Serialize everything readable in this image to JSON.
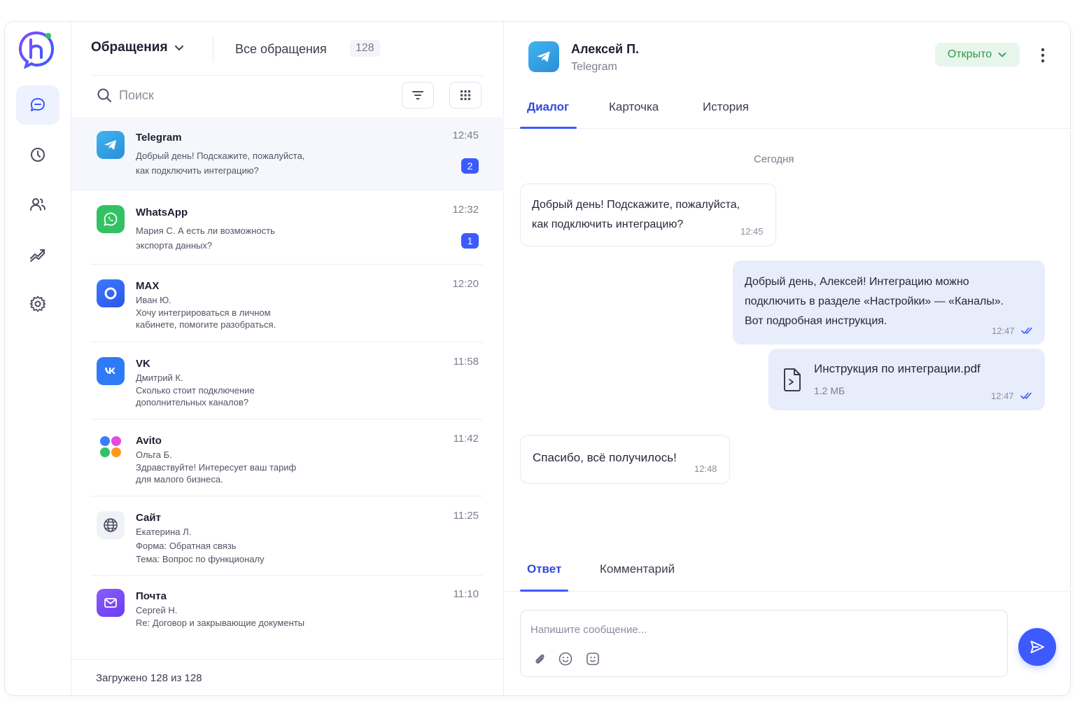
{
  "header": {
    "folder_label": "Обращения",
    "all_label": "Все обращения",
    "all_count": "128"
  },
  "search": {
    "placeholder": "Поиск"
  },
  "conversations": [
    {
      "channel": "Telegram",
      "lines": [
        "Добрый день! Подскажите, пожалуйста,",
        "как подключить интеграцию?"
      ],
      "time": "12:45",
      "badge": "2",
      "icon": "telegram-icon"
    },
    {
      "channel": "WhatsApp",
      "lines": [
        "Мария С. А есть ли возможность",
        "экспорта данных?"
      ],
      "time": "12:32",
      "badge": "1",
      "icon": "whatsapp-icon"
    },
    {
      "channel": "MAX",
      "lines": [
        "Иван Ю.",
        "Хочу интегрироваться в личном",
        "кабинете, помогите разобраться."
      ],
      "time": "12:20",
      "icon": "max-icon"
    },
    {
      "channel": "VK",
      "lines": [
        "Дмитрий К.",
        "Сколько стоит подключение",
        "дополнительных каналов?"
      ],
      "time": "11:58",
      "icon": "vk-icon"
    },
    {
      "channel": "Avito",
      "lines": [
        "Ольга Б.",
        "Здравствуйте! Интересует ваш тариф",
        "для малого бизнеса."
      ],
      "time": "11:42",
      "icon": "avito-icon"
    },
    {
      "channel": "Сайт",
      "lines": [
        "Екатерина Л.",
        "Форма: Обратная связь",
        "Тема: Вопрос по функционалу"
      ],
      "time": "11:25",
      "icon": "globe-icon"
    },
    {
      "channel": "Почта",
      "lines": [
        "Сергей Н.",
        "Re: Договор и закрывающие документы"
      ],
      "time": "11:10",
      "icon": "mail-icon"
    }
  ],
  "footer": {
    "loaded": "Загружено 128 из 128"
  },
  "chat": {
    "name": "Алексей П.",
    "channel": "Telegram",
    "status": "Открыто",
    "tabs": [
      "Диалог",
      "Карточка",
      "История"
    ],
    "day": "Сегодня",
    "messages": [
      {
        "dir": "in",
        "lines": [
          "Добрый день! Подскажите, пожалуйста,",
          "как подключить интеграцию?"
        ],
        "time": "12:45"
      },
      {
        "dir": "out",
        "lines": [
          "Добрый день, Алексей! Интеграцию можно",
          "подключить в разделе «Настройки» — «Каналы».",
          "Вот подробная инструкция."
        ],
        "time": "12:47"
      },
      {
        "dir": "out",
        "file_name": "Инструкция по интеграции.pdf",
        "file_size": "1.2 МБ",
        "time": "12:47"
      },
      {
        "dir": "in",
        "lines": [
          "Спасибо, всё получилось!"
        ],
        "time": "12:48"
      }
    ],
    "reply_tabs": [
      "Ответ",
      "Комментарий"
    ],
    "composer_placeholder": "Напишите сообщение..."
  },
  "colors": {
    "accent": "#3d5afe",
    "status_green": "#2d9a4b",
    "outgoing_bubble": "#e8edfc"
  }
}
